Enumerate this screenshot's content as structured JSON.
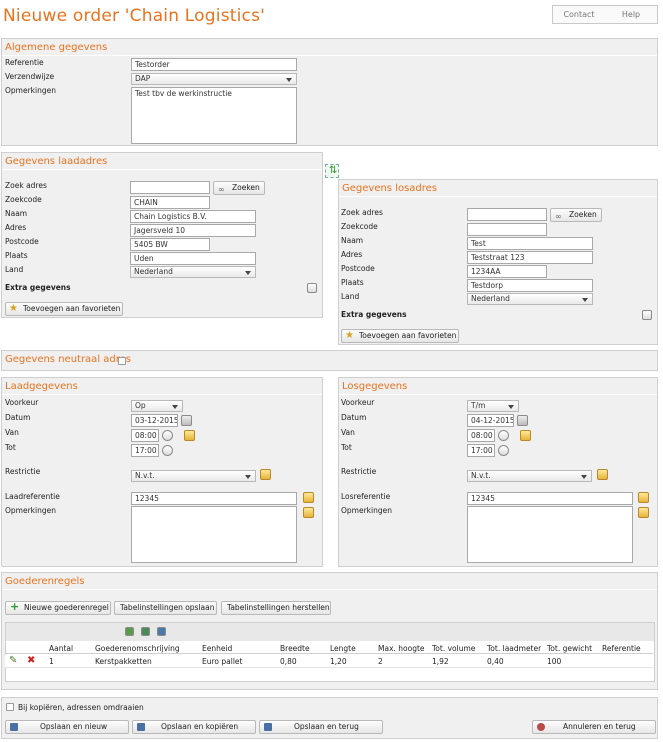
{
  "page": {
    "title": "Nieuwe order 'Chain Logistics'"
  },
  "topnav": {
    "contact": "Contact",
    "help": "Help"
  },
  "algemeen": {
    "header": "Algemene gegevens",
    "referentie_label": "Referentie",
    "referentie_value": "Testorder",
    "verzendwijze_label": "Verzendwijze",
    "verzendwijze_value": "DAP",
    "opmerkingen_label": "Opmerkingen",
    "opmerkingen_value": "Test tbv de werkinstructie"
  },
  "laadadres": {
    "header": "Gegevens laadadres",
    "zoek_label": "Zoek adres",
    "zoek_value": "",
    "zoek_button": "Zoeken",
    "zoekcode_label": "Zoekcode",
    "zoekcode_value": "CHAIN",
    "naam_label": "Naam",
    "naam_value": "Chain Logistics B.V.",
    "adres_label": "Adres",
    "adres_value": "Jagersveld 10",
    "postcode_label": "Postcode",
    "postcode_value": "5405 BW",
    "plaats_label": "Plaats",
    "plaats_value": "Uden",
    "land_label": "Land",
    "land_value": "Nederland",
    "extra_label": "Extra gegevens",
    "fav_button": "Toevoegen aan favorieten"
  },
  "losadres": {
    "header": "Gegevens losadres",
    "zoek_label": "Zoek adres",
    "zoek_value": "",
    "zoek_button": "Zoeken",
    "zoekcode_label": "Zoekcode",
    "zoekcode_value": "",
    "naam_label": "Naam",
    "naam_value": "Test",
    "adres_label": "Adres",
    "adres_value": "Teststraat 123",
    "postcode_label": "Postcode",
    "postcode_value": "1234AA",
    "plaats_label": "Plaats",
    "plaats_value": "Testdorp",
    "land_label": "Land",
    "land_value": "Nederland",
    "extra_label": "Extra gegevens",
    "fav_button": "Toevoegen aan favorieten"
  },
  "neutraal": {
    "header": "Gegevens neutraal adres"
  },
  "laad": {
    "header": "Laadgegevens",
    "voorkeur_label": "Voorkeur",
    "voorkeur_value": "Op",
    "datum_label": "Datum",
    "datum_value": "03-12-2015",
    "van_label": "Van",
    "van_value": "08:00",
    "tot_label": "Tot",
    "tot_value": "17:00",
    "restrictie_label": "Restrictie",
    "restrictie_value": "N.v.t.",
    "ref_label": "Laadreferentie",
    "ref_value": "12345",
    "opm_label": "Opmerkingen"
  },
  "los": {
    "header": "Losgegevens",
    "voorkeur_label": "Voorkeur",
    "voorkeur_value": "T/m",
    "datum_label": "Datum",
    "datum_value": "04-12-2015",
    "van_label": "Van",
    "van_value": "08:00",
    "tot_label": "Tot",
    "tot_value": "17:00",
    "restrictie_label": "Restrictie",
    "restrictie_value": "N.v.t.",
    "ref_label": "Losreferentie",
    "ref_value": "12345",
    "opm_label": "Opmerkingen"
  },
  "goederen": {
    "header": "Goederenregels",
    "new_button": "Nieuwe goederenregel",
    "save_settings": "Tabelinstellingen opslaan",
    "restore_settings": "Tabelinstellingen herstellen",
    "columns": [
      "Aantal",
      "Goederenomschrijving",
      "Eenheid",
      "Breedte",
      "Lengte",
      "Max. hoogte",
      "Tot. volume",
      "Tot. laadmeter",
      "Tot. gewicht",
      "Referentie"
    ],
    "rows": [
      [
        "1",
        "Kerstpakketten",
        "Euro pallet",
        "0,80",
        "1,20",
        "2",
        "1,92",
        "0,40",
        "100",
        ""
      ]
    ]
  },
  "footer": {
    "copy_label": "Bij kopiëren, adressen omdraaien",
    "btn_new": "Opslaan en nieuw",
    "btn_copy": "Opslaan en kopiëren",
    "btn_back": "Opslaan en terug",
    "btn_cancel": "Annuleren en terug"
  },
  "colors": {
    "accent": "#e8731e",
    "panel_bg": "#f0f0f0",
    "border": "#cfcfcf"
  }
}
